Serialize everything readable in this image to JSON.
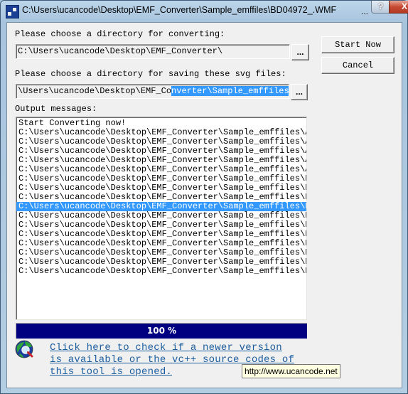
{
  "window": {
    "title": "C:\\Users\\ucancode\\Desktop\\EMF_Converter\\Sample_emffiles\\BD04972_.WMF",
    "title_overflow": "...",
    "help_label": "?",
    "close_label": "X"
  },
  "source_dir": {
    "label": "Please choose a directory for converting:",
    "value": "C:\\Users\\ucancode\\Desktop\\EMF_Converter\\",
    "browse_label": "..."
  },
  "output_dir": {
    "label": "Please choose a directory for saving these svg files:",
    "value_unselected": "\\Users\\ucancode\\Desktop\\EMF_Co",
    "value_selected": "nverter\\Sample_emffiles\\",
    "browse_label": "..."
  },
  "actions": {
    "start_label": "Start Now",
    "cancel_label": "Cancel"
  },
  "output": {
    "label": "Output messages:",
    "messages": [
      "Start Converting now!",
      "C:\\Users\\ucancode\\Desktop\\EMF_Converter\\Sample_emffiles\\AN",
      "C:\\Users\\ucancode\\Desktop\\EMF_Converter\\Sample_emffiles\\AN",
      "C:\\Users\\ucancode\\Desktop\\EMF_Converter\\Sample_emffiles\\AN",
      "C:\\Users\\ucancode\\Desktop\\EMF_Converter\\Sample_emffiles\\AN",
      "C:\\Users\\ucancode\\Desktop\\EMF_Converter\\Sample_emffiles\\AN",
      "C:\\Users\\ucancode\\Desktop\\EMF_Converter\\Sample_emffiles\\BD",
      "C:\\Users\\ucancode\\Desktop\\EMF_Converter\\Sample_emffiles\\BD",
      "C:\\Users\\ucancode\\Desktop\\EMF_Converter\\Sample_emffiles\\BD",
      "C:\\Users\\ucancode\\Desktop\\EMF_Converter\\Sample_emffiles\\BD",
      "C:\\Users\\ucancode\\Desktop\\EMF_Converter\\Sample_emffiles\\BD",
      "C:\\Users\\ucancode\\Desktop\\EMF_Converter\\Sample_emffiles\\BD",
      "C:\\Users\\ucancode\\Desktop\\EMF_Converter\\Sample_emffiles\\BD",
      "C:\\Users\\ucancode\\Desktop\\EMF_Converter\\Sample_emffiles\\BD",
      "C:\\Users\\ucancode\\Desktop\\EMF_Converter\\Sample_emffiles\\BD",
      "C:\\Users\\ucancode\\Desktop\\EMF_Converter\\Sample_emffiles\\BD",
      "C:\\Users\\ucancode\\Desktop\\EMF_Converter\\Sample_emffiles\\BD"
    ],
    "selected_index": 9
  },
  "progress": {
    "percent": 100,
    "label": "100 %",
    "fill_color": "#000080"
  },
  "update_link": {
    "lines": [
      "Click here to check if a newer version ",
      "is available or the vc++ source codes of",
      "this tool is opened. "
    ],
    "color": "#1b5ea0"
  },
  "tooltip": {
    "text": "http://www.ucancode.net"
  }
}
